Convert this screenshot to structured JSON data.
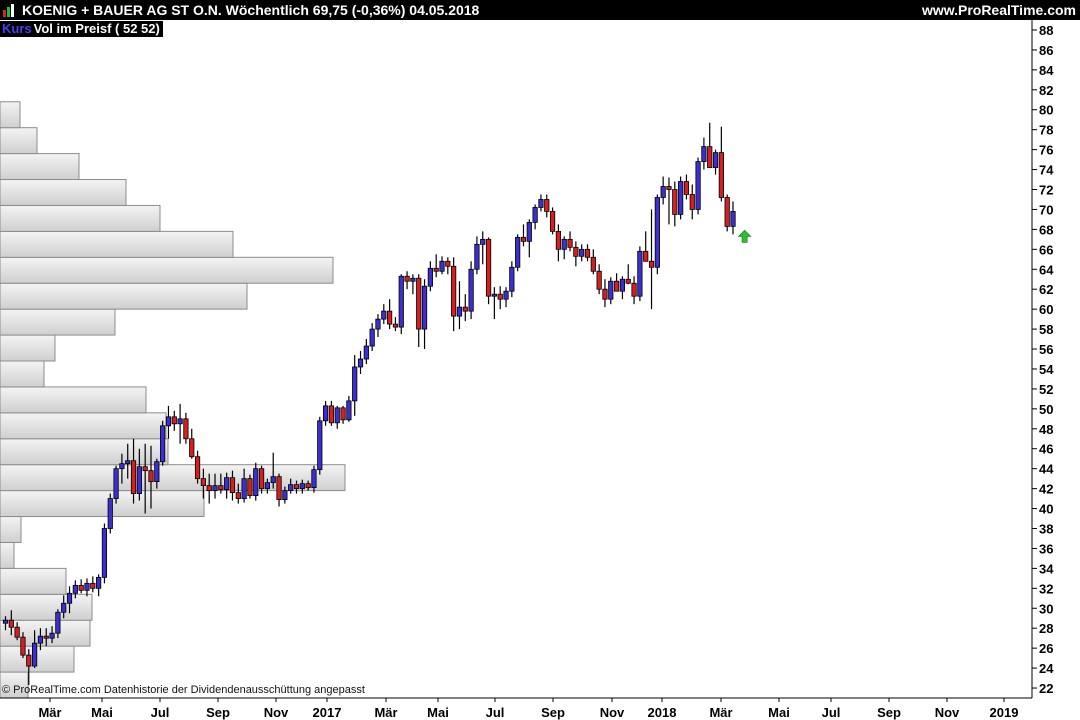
{
  "header": {
    "title": "KOENIG + BAUER AG ST O.N.   Wöchentlich   69,75 (-0,36%)   04.05.2018",
    "site": "www.ProRealTime.com"
  },
  "legend": {
    "kurs": "Kurs",
    "vol": "Vol im Preisf ( 52 52)"
  },
  "footer": {
    "copyright": "© ProRealTime.com  Datenhistorie der Dividendenausschüttung angepasst"
  },
  "colors": {
    "up": "#3b2fd0",
    "down": "#d42020",
    "arrow": "#2fbf2f",
    "background": "#ffffff"
  },
  "chart_data": {
    "type": "candlestick",
    "title": "KOENIG + BAUER AG ST O.N.",
    "period": "Wöchentlich",
    "last": "69,75 (-0,36%)",
    "date": "04.05.2018",
    "ylim": [
      21,
      89
    ],
    "y_ticks": [
      22,
      24,
      26,
      28,
      30,
      32,
      34,
      36,
      38,
      40,
      42,
      44,
      46,
      48,
      50,
      52,
      54,
      56,
      58,
      60,
      62,
      64,
      66,
      68,
      70,
      72,
      74,
      76,
      78,
      80,
      82,
      84,
      86,
      88
    ],
    "x_labels": [
      "Mär",
      "Mai",
      "Jul",
      "Sep",
      "Nov",
      "2017",
      "Mär",
      "Mai",
      "Jul",
      "Sep",
      "Nov",
      "2018",
      "Mär",
      "Mai",
      "Jul",
      "Sep",
      "Nov",
      "2019"
    ],
    "candles": [
      [
        28.5,
        29.2,
        27.8,
        28.8
      ],
      [
        28.8,
        29.8,
        27.3,
        28.1
      ],
      [
        28.1,
        28.6,
        26.8,
        27.1
      ],
      [
        27.1,
        27.6,
        25.0,
        25.3
      ],
      [
        25.3,
        25.9,
        22.3,
        24.2
      ],
      [
        24.2,
        27.8,
        24.0,
        26.5
      ],
      [
        26.5,
        28.0,
        25.8,
        27.2
      ],
      [
        27.2,
        28.0,
        26.2,
        27.0
      ],
      [
        27.0,
        28.2,
        26.5,
        27.5
      ],
      [
        27.5,
        29.9,
        27.0,
        29.6
      ],
      [
        29.6,
        31.3,
        29.0,
        30.5
      ],
      [
        30.5,
        32.2,
        29.5,
        31.5
      ],
      [
        31.5,
        32.8,
        31.0,
        32.3
      ],
      [
        32.3,
        32.9,
        31.5,
        31.8
      ],
      [
        31.8,
        33.0,
        31.2,
        32.5
      ],
      [
        32.5,
        33.2,
        31.6,
        32.0
      ],
      [
        32.0,
        33.4,
        31.2,
        33.1
      ],
      [
        33.1,
        38.5,
        32.5,
        38.0
      ],
      [
        38.0,
        41.5,
        37.5,
        41.0
      ],
      [
        41.0,
        44.3,
        40.5,
        44.0
      ],
      [
        44.0,
        45.5,
        42.5,
        44.5
      ],
      [
        44.5,
        46.5,
        43.0,
        44.8
      ],
      [
        44.8,
        47.0,
        40.5,
        41.5
      ],
      [
        41.5,
        46.0,
        40.8,
        44.2
      ],
      [
        44.2,
        46.5,
        39.5,
        43.8
      ],
      [
        43.8,
        46.3,
        40.0,
        42.7
      ],
      [
        42.7,
        45.0,
        42.0,
        44.7
      ],
      [
        44.7,
        48.8,
        44.3,
        48.3
      ],
      [
        48.3,
        50.3,
        47.0,
        49.2
      ],
      [
        49.2,
        49.8,
        47.8,
        48.5
      ],
      [
        48.5,
        50.5,
        46.5,
        49.0
      ],
      [
        49.0,
        49.6,
        46.5,
        47.0
      ],
      [
        47.0,
        48.0,
        45.0,
        45.2
      ],
      [
        45.2,
        45.8,
        42.5,
        43.0
      ],
      [
        43.0,
        44.0,
        41.0,
        42.3
      ],
      [
        42.3,
        43.5,
        40.5,
        41.8
      ],
      [
        41.8,
        43.5,
        41.0,
        42.3
      ],
      [
        42.3,
        43.5,
        41.5,
        41.9
      ],
      [
        41.9,
        43.6,
        41.0,
        43.1
      ],
      [
        43.1,
        43.8,
        40.8,
        41.6
      ],
      [
        41.6,
        42.5,
        40.5,
        41.0
      ],
      [
        41.0,
        44.0,
        40.6,
        43.0
      ],
      [
        43.0,
        43.4,
        41.0,
        41.3
      ],
      [
        41.3,
        44.6,
        40.8,
        44.0
      ],
      [
        44.0,
        44.3,
        41.5,
        42.0
      ],
      [
        42.0,
        43.0,
        41.5,
        42.6
      ],
      [
        42.6,
        45.6,
        42.0,
        43.2
      ],
      [
        43.2,
        43.5,
        40.2,
        40.9
      ],
      [
        40.9,
        42.2,
        40.5,
        41.8
      ],
      [
        41.8,
        43.0,
        41.5,
        42.4
      ],
      [
        42.4,
        42.8,
        41.5,
        42.0
      ],
      [
        42.0,
        42.9,
        41.5,
        42.5
      ],
      [
        42.5,
        42.8,
        41.8,
        42.1
      ],
      [
        42.1,
        44.3,
        41.6,
        43.9
      ],
      [
        43.9,
        49.2,
        43.4,
        48.8
      ],
      [
        48.8,
        50.8,
        48.3,
        50.3
      ],
      [
        50.3,
        50.8,
        48.3,
        48.6
      ],
      [
        48.6,
        50.3,
        48.0,
        50.1
      ],
      [
        50.1,
        50.3,
        48.5,
        48.9
      ],
      [
        48.9,
        51.3,
        48.7,
        50.8
      ],
      [
        50.8,
        55.4,
        49.3,
        54.2
      ],
      [
        54.2,
        55.8,
        53.5,
        55.0
      ],
      [
        55.0,
        57.0,
        54.5,
        56.3
      ],
      [
        56.3,
        58.6,
        55.8,
        58.0
      ],
      [
        58.0,
        59.5,
        57.2,
        59.0
      ],
      [
        59.0,
        60.5,
        58.5,
        59.8
      ],
      [
        59.8,
        61.0,
        58.0,
        58.5
      ],
      [
        58.5,
        59.2,
        57.8,
        58.2
      ],
      [
        58.2,
        63.5,
        57.5,
        63.3
      ],
      [
        63.3,
        63.8,
        62.0,
        62.8
      ],
      [
        62.8,
        63.5,
        61.5,
        63.1
      ],
      [
        63.1,
        63.5,
        56.2,
        58.0
      ],
      [
        58.0,
        63.0,
        56.0,
        62.3
      ],
      [
        62.3,
        64.8,
        61.8,
        64.1
      ],
      [
        64.1,
        65.5,
        63.2,
        63.8
      ],
      [
        63.8,
        65.3,
        63.5,
        64.8
      ],
      [
        64.8,
        65.2,
        63.5,
        64.3
      ],
      [
        64.3,
        65.2,
        57.8,
        59.3
      ],
      [
        59.3,
        62.8,
        58.0,
        60.2
      ],
      [
        60.2,
        61.5,
        58.8,
        59.8
      ],
      [
        59.8,
        64.8,
        59.0,
        64.0
      ],
      [
        64.0,
        67.3,
        63.5,
        66.5
      ],
      [
        66.5,
        67.8,
        64.5,
        67.0
      ],
      [
        67.0,
        67.2,
        60.5,
        61.3
      ],
      [
        61.3,
        62.2,
        59.0,
        61.5
      ],
      [
        61.5,
        62.3,
        60.0,
        61.0
      ],
      [
        61.0,
        62.2,
        60.2,
        61.8
      ],
      [
        61.8,
        64.8,
        61.2,
        64.2
      ],
      [
        64.2,
        67.5,
        63.8,
        67.2
      ],
      [
        67.2,
        68.5,
        66.3,
        66.8
      ],
      [
        66.8,
        69.0,
        65.2,
        68.7
      ],
      [
        68.7,
        70.5,
        68.0,
        70.2
      ],
      [
        70.2,
        71.5,
        69.8,
        71.0
      ],
      [
        71.0,
        71.5,
        69.2,
        69.8
      ],
      [
        69.8,
        70.2,
        67.5,
        67.8
      ],
      [
        67.8,
        68.5,
        64.8,
        66.0
      ],
      [
        66.0,
        67.3,
        65.0,
        67.0
      ],
      [
        67.0,
        67.8,
        65.8,
        66.2
      ],
      [
        66.2,
        66.8,
        64.3,
        65.3
      ],
      [
        65.3,
        66.5,
        64.8,
        66.0
      ],
      [
        66.0,
        66.5,
        64.8,
        65.2
      ],
      [
        65.2,
        66.0,
        63.5,
        63.8
      ],
      [
        63.8,
        64.5,
        61.5,
        62.0
      ],
      [
        62.0,
        63.0,
        60.2,
        61.0
      ],
      [
        61.0,
        63.2,
        60.5,
        62.8
      ],
      [
        62.8,
        63.6,
        62.0,
        61.8
      ],
      [
        61.8,
        63.3,
        61.0,
        63.0
      ],
      [
        63.0,
        64.5,
        62.5,
        62.6
      ],
      [
        62.6,
        63.3,
        60.5,
        61.3
      ],
      [
        61.3,
        66.3,
        60.8,
        65.8
      ],
      [
        65.8,
        67.8,
        65.2,
        64.8
      ],
      [
        64.8,
        70.0,
        60.0,
        64.2
      ],
      [
        64.2,
        71.5,
        63.5,
        71.2
      ],
      [
        71.2,
        73.3,
        70.5,
        72.3
      ],
      [
        72.3,
        73.2,
        68.5,
        72.0
      ],
      [
        72.0,
        72.8,
        68.3,
        69.5
      ],
      [
        69.5,
        73.3,
        69.0,
        72.8
      ],
      [
        72.8,
        73.5,
        71.0,
        71.5
      ],
      [
        71.5,
        72.5,
        69.0,
        70.0
      ],
      [
        70.0,
        75.2,
        69.5,
        74.8
      ],
      [
        74.8,
        77.2,
        74.0,
        76.3
      ],
      [
        76.3,
        78.7,
        74.5,
        74.2
      ],
      [
        74.2,
        76.0,
        73.5,
        75.7
      ],
      [
        75.7,
        78.3,
        70.8,
        71.2
      ],
      [
        71.2,
        71.5,
        67.8,
        68.3
      ],
      [
        68.3,
        70.8,
        67.5,
        69.8
      ]
    ],
    "volume_profile": [
      {
        "from": 21,
        "to": 23.6,
        "value": 28
      },
      {
        "from": 23.6,
        "to": 26.2,
        "value": 74
      },
      {
        "from": 26.2,
        "to": 28.8,
        "value": 90
      },
      {
        "from": 28.8,
        "to": 31.4,
        "value": 92
      },
      {
        "from": 31.4,
        "to": 34.0,
        "value": 66
      },
      {
        "from": 34.0,
        "to": 36.6,
        "value": 14
      },
      {
        "from": 36.6,
        "to": 39.2,
        "value": 21
      },
      {
        "from": 39.2,
        "to": 41.8,
        "value": 204
      },
      {
        "from": 41.8,
        "to": 44.4,
        "value": 345
      },
      {
        "from": 44.4,
        "to": 47.0,
        "value": 168
      },
      {
        "from": 47.0,
        "to": 49.6,
        "value": 166
      },
      {
        "from": 49.6,
        "to": 52.2,
        "value": 146
      },
      {
        "from": 52.2,
        "to": 54.8,
        "value": 44
      },
      {
        "from": 54.8,
        "to": 57.4,
        "value": 55
      },
      {
        "from": 57.4,
        "to": 60.0,
        "value": 115
      },
      {
        "from": 60.0,
        "to": 62.6,
        "value": 247
      },
      {
        "from": 62.6,
        "to": 65.2,
        "value": 333
      },
      {
        "from": 65.2,
        "to": 67.8,
        "value": 233
      },
      {
        "from": 67.8,
        "to": 70.4,
        "value": 160
      },
      {
        "from": 70.4,
        "to": 73.0,
        "value": 126
      },
      {
        "from": 73.0,
        "to": 75.6,
        "value": 79
      },
      {
        "from": 75.6,
        "to": 78.2,
        "value": 37
      },
      {
        "from": 78.2,
        "to": 80.8,
        "value": 20
      }
    ],
    "signal": {
      "type": "up-arrow",
      "index": 127,
      "value": 67.3
    }
  }
}
